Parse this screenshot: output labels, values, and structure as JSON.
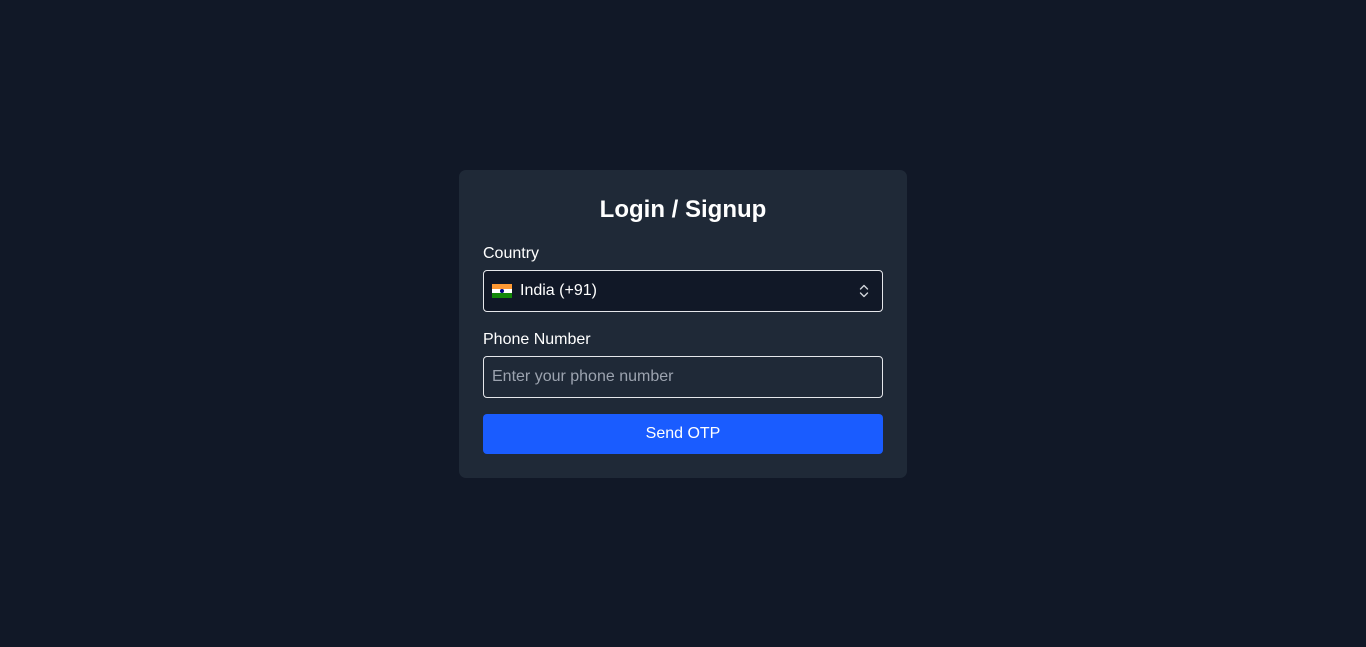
{
  "theme": {
    "background": "#111827",
    "card": "#1f2937",
    "accent": "#1a5cff"
  },
  "login": {
    "title": "Login / Signup",
    "country": {
      "label": "Country",
      "selected": "India (+91)",
      "flag_icon": "india-flag-icon"
    },
    "phone": {
      "label": "Phone Number",
      "value": "",
      "placeholder": "Enter your phone number"
    },
    "submit_label": "Send OTP"
  }
}
